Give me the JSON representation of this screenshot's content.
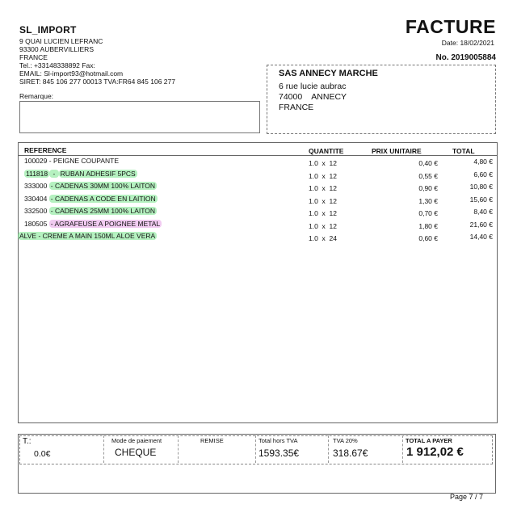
{
  "company": {
    "name": "SL_IMPORT",
    "address_lines": [
      "9 QUAI LUCIEN LEFRANC",
      "93300 AUBERVILLIERS",
      "FRANCE",
      "Tel.: +33148338892   Fax:",
      "EMAIL: Sl-import93@hotmail.com",
      "SIRET: 845 106 277 00013 TVA:FR64 845 106 277"
    ]
  },
  "invoice": {
    "title": "FACTURE",
    "date_label": "Date: 18/02/2021",
    "number_label": "No. 2019005884"
  },
  "remark": {
    "label": "Remarque:"
  },
  "client": {
    "name": "SAS ANNECY MARCHE",
    "address_lines": [
      "6 rue lucie aubrac",
      "74000    ANNECY",
      "FRANCE"
    ]
  },
  "items_table": {
    "headers": {
      "reference": "REFERENCE",
      "quantity": "QUANTITE",
      "unit_price": "PRIX UNITAIRE",
      "total": "TOTAL"
    },
    "rows": [
      {
        "ref": "100029",
        "desc": "PEIGNE COUPANTE",
        "qty": "1.0  x  12",
        "price": "0,40 €",
        "total": "4,80 €",
        "highlight": "none"
      },
      {
        "ref": "111818",
        "desc": "RUBAN ADHESIF 5PCS",
        "qty": "1.0  x  12",
        "price": "0,55 €",
        "total": "6,60 €",
        "highlight": "green"
      },
      {
        "ref": "333000",
        "desc": "CADENAS 30MM 100% LAITON",
        "qty": "1.0  x  12",
        "price": "0,90 €",
        "total": "10,80 €",
        "highlight": "green"
      },
      {
        "ref": "330404",
        "desc": "CADENAS A CODE EN LAITION",
        "qty": "1.0  x  12",
        "price": "1,30 €",
        "total": "15,60 €",
        "highlight": "green"
      },
      {
        "ref": "332500",
        "desc": "CADENAS 25MM 100% LAITON",
        "qty": "1.0  x  12",
        "price": "0,70 €",
        "total": "8,40 €",
        "highlight": "green"
      },
      {
        "ref": "180505",
        "desc": "AGRAFEUSE A POIGNEE METAL",
        "qty": "1.0  x  12",
        "price": "1,80 €",
        "total": "21,60 €",
        "highlight": "pink"
      },
      {
        "ref": "ALVE",
        "desc": "CREME A MAIN 150ML ALOE VERA",
        "qty": "1.0  x  24",
        "price": "0,60 €",
        "total": "14,40 €",
        "highlight": "green"
      }
    ]
  },
  "totals": {
    "t_label": "T.:",
    "t_value": "0.0€",
    "payment_label": "Mode de paiement",
    "payment_value": "CHEQUE",
    "remise_label": "REMISE",
    "ht_label": "Total hors TVA",
    "ht_value": "1593.35€",
    "tva_label": "TVA 20%",
    "tva_value": "318.67€",
    "pay_label": "TOTAL A PAYER",
    "pay_value": "1 912,02 €"
  },
  "page": {
    "label": "Page 7 / 7"
  },
  "colors": {
    "highlight_green": "#78e68c",
    "highlight_pink": "#e6a0e6"
  }
}
